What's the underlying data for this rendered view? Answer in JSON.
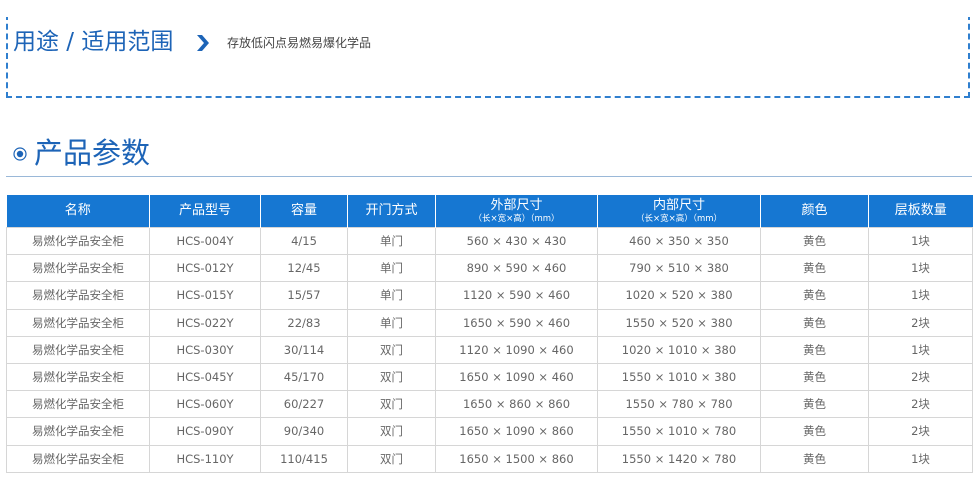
{
  "usage": {
    "title": "用途 / 适用范围",
    "arrow_icon": "chevron-right-icon",
    "description": "存放低闪点易燃易爆化学品"
  },
  "section": {
    "title": "产品参数",
    "bullet_icon": "circle-bullet-icon"
  },
  "colors": {
    "brand_blue": "#1d64b7",
    "header_bg": "#1677d2",
    "border": "#d6d6d6"
  },
  "table": {
    "headers": [
      {
        "label": "名称",
        "sub": ""
      },
      {
        "label": "产品型号",
        "sub": ""
      },
      {
        "label": "容量",
        "sub": ""
      },
      {
        "label": "开门方式",
        "sub": ""
      },
      {
        "label": "外部尺寸",
        "sub": "（长×宽×高）（mm）"
      },
      {
        "label": "内部尺寸",
        "sub": "（长×宽×高）（mm）"
      },
      {
        "label": "颜色",
        "sub": ""
      },
      {
        "label": "层板数量",
        "sub": ""
      }
    ],
    "rows": [
      [
        "易燃化学品安全柜",
        "HCS-004Y",
        "4/15",
        "单门",
        "560 × 430 × 430",
        "460 × 350 × 350",
        "黄色",
        "1块"
      ],
      [
        "易燃化学品安全柜",
        "HCS-012Y",
        "12/45",
        "单门",
        "890 × 590 × 460",
        "790 × 510 × 380",
        "黄色",
        "1块"
      ],
      [
        "易燃化学品安全柜",
        "HCS-015Y",
        "15/57",
        "单门",
        "1120 × 590 × 460",
        "1020 × 520 × 380",
        "黄色",
        "1块"
      ],
      [
        "易燃化学品安全柜",
        "HCS-022Y",
        "22/83",
        "单门",
        "1650 × 590 × 460",
        "1550 × 520 × 380",
        "黄色",
        "2块"
      ],
      [
        "易燃化学品安全柜",
        "HCS-030Y",
        "30/114",
        "双门",
        "1120 × 1090 × 460",
        "1020 × 1010 × 380",
        "黄色",
        "1块"
      ],
      [
        "易燃化学品安全柜",
        "HCS-045Y",
        "45/170",
        "双门",
        "1650 × 1090 × 460",
        "1550 × 1010 × 380",
        "黄色",
        "2块"
      ],
      [
        "易燃化学品安全柜",
        "HCS-060Y",
        "60/227",
        "双门",
        "1650 × 860 × 860",
        "1550 × 780 × 780",
        "黄色",
        "2块"
      ],
      [
        "易燃化学品安全柜",
        "HCS-090Y",
        "90/340",
        "双门",
        "1650 × 1090 × 860",
        "1550 × 1010 × 780",
        "黄色",
        "2块"
      ],
      [
        "易燃化学品安全柜",
        "HCS-110Y",
        "110/415",
        "双门",
        "1650 × 1500 × 860",
        "1550 × 1420 × 780",
        "黄色",
        "1块"
      ]
    ]
  }
}
